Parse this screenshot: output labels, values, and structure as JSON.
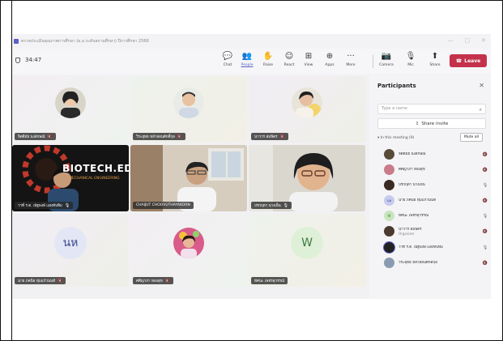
{
  "window": {
    "title": "ตรวจประเมินคุณภาพการศึกษา (ผ.อ.ระดับสถานศึกษา) ปีการศึกษา 2566"
  },
  "toolbar": {
    "timer": "34:47",
    "items": [
      {
        "label": "Chat",
        "icon": "chat-icon"
      },
      {
        "label": "People",
        "icon": "people-icon"
      },
      {
        "label": "Raise",
        "icon": "raise-hand-icon"
      },
      {
        "label": "React",
        "icon": "react-icon"
      },
      {
        "label": "View",
        "icon": "view-icon"
      },
      {
        "label": "Apps",
        "icon": "apps-icon"
      },
      {
        "label": "More",
        "icon": "more-icon"
      },
      {
        "label": "Camera",
        "icon": "camera-icon"
      },
      {
        "label": "Mic",
        "icon": "mic-icon"
      },
      {
        "label": "Share",
        "icon": "share-icon"
      }
    ],
    "leave": "Leave"
  },
  "tiles": [
    {
      "name": "จิตติมัย นงลักษณ์"
    },
    {
      "name": "วิระยุทธ หล้าสอนศักดิ์กุล"
    },
    {
      "name": "นาวาร สมพิตร"
    },
    {
      "name": "ว่าที่ ร.ต. ณัฐพงษ์ แสงทับทิม",
      "banner": "BIOTECH.ED",
      "banner_sub": "MECHANICAL ENGINEERING"
    },
    {
      "name": "CHAIJUT CHOOVUTHAYAKORN"
    },
    {
      "name": "ปรกฤตา นางเย็น"
    },
    {
      "name": "นาย ภคนิธ ทุ่มแก้วนนท์",
      "initials": "นห"
    },
    {
      "name": "ศศิญาภา ทองสุข"
    },
    {
      "name": "ทัศนะ เพชรสุวรรณ์",
      "initials": "W"
    }
  ],
  "panel": {
    "title": "Participants",
    "search_placeholder": "Type a name",
    "share_invite": "Share invite",
    "section": "In this meeting (9)",
    "mute_all": "Mute all",
    "participants": [
      {
        "name": "จิตติมัย นงลักษณ์",
        "role": ""
      },
      {
        "name": "ศศิญาภา ทองสุข",
        "role": ""
      },
      {
        "name": "ปรกฤตา นางเย็น",
        "role": ""
      },
      {
        "name": "นาย ภคนิธ ทุ่มแก้วนนท์",
        "role": "",
        "initials": "นห"
      },
      {
        "name": "ทัศนะ เพชรสุวรรณ์",
        "role": "",
        "initials": "W"
      },
      {
        "name": "นาวาร สมพิตร",
        "role": "Organizer"
      },
      {
        "name": "ว่าที่ ร.ต. ณัฐพงษ์ แสงทับทิม",
        "role": ""
      },
      {
        "name": "วิระยุทธ หล้าสอนศักดิ์กุล",
        "role": ""
      }
    ]
  },
  "colors": {
    "accent": "#5b5fc7",
    "leave": "#c4314b"
  }
}
